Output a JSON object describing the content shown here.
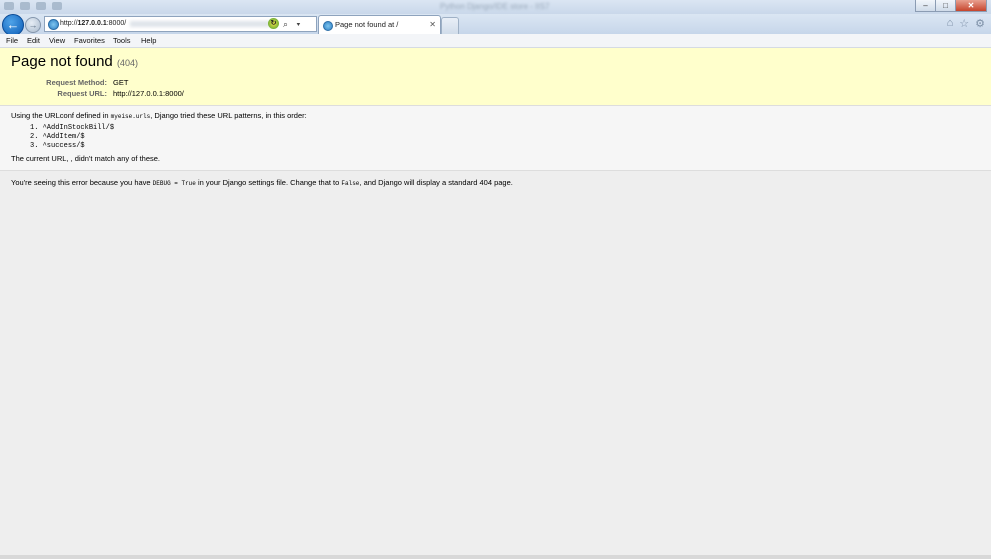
{
  "window": {
    "title": "Python Django/IDE store - IIS7",
    "controls": {
      "minimize": "–",
      "maximize": "□",
      "close": "✕"
    }
  },
  "nav": {
    "address": {
      "host": "127.0.0.1",
      "prefix": "http://",
      "suffix": ":8000/"
    },
    "tab": {
      "label": "Page not found at /",
      "close": "✕"
    },
    "tools": "⌕ ▾ ↻"
  },
  "toolbar_icons": [
    "home-icon",
    "star-icon",
    "gear-icon"
  ],
  "menu": [
    "File",
    "Edit",
    "View",
    "Favorites",
    "Tools",
    "Help"
  ],
  "page": {
    "title": "Page not found",
    "code": "(404)",
    "request_method_label": "Request Method:",
    "request_method": "GET",
    "request_url_label": "Request URL:",
    "request_url": "http://127.0.0.1:8000/",
    "urlconf_prefix": "Using the URLconf defined in ",
    "urlconf_module": "myeise.urls",
    "urlconf_suffix": ", Django tried these URL patterns, in this order:",
    "patterns": [
      {
        "num": "1.",
        "pattern": "^AddInStockBill/$"
      },
      {
        "num": "2.",
        "pattern": "^AddItem/$"
      },
      {
        "num": "3.",
        "pattern": "^success/$"
      }
    ],
    "current_url_msg": "The current URL, , didn't match any of these.",
    "debug_prefix": "You're seeing this error because you have ",
    "debug_code": "DEBUG = True",
    "debug_middle": " in your Django settings file. Change that to ",
    "debug_false": "False",
    "debug_suffix": ", and Django will display a standard 404 page."
  }
}
